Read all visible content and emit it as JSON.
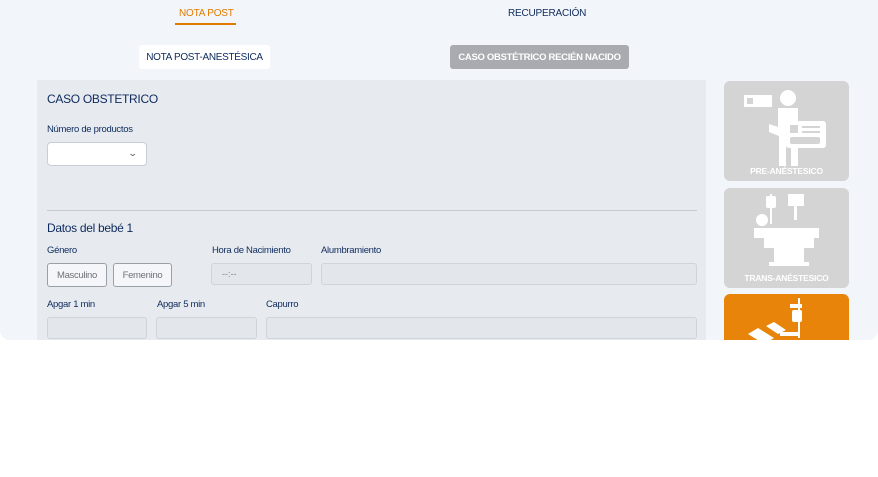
{
  "tabs": {
    "nota_post": "NOTA POST",
    "recuperacion": "RECUPERACIÓN"
  },
  "subtabs": {
    "post_anestesica": "NOTA POST-ANESTÉSICA",
    "caso_obstetrico": "CASO OBSTÉTRICO RECIÉN NACIDO"
  },
  "form": {
    "section_title": "CASO OBSTETRICO",
    "num_productos_label": "Número de productos",
    "num_productos_value": "",
    "baby_title": "Datos del bebé 1",
    "genero_label": "Género",
    "masculino": "Masculino",
    "femenino": "Femenino",
    "hora_label": "Hora de Nacimiento",
    "hora_placeholder": "--:--",
    "alumbramiento_label": "Alumbramiento",
    "apgar1_label": "Apgar 1 min",
    "apgar5_label": "Apgar 5 min",
    "capurro_label": "Capurro"
  },
  "side": {
    "pre_label": "PRE-ANÉSTESICO",
    "trans_label": "TRANS-ANÉSTESICO"
  },
  "colors": {
    "accent": "#e07b00",
    "navy": "#0e2a5c",
    "card_inactive": "#d4d4d4",
    "card_active": "#e88409"
  },
  "icons": [
    "doctor-monitor-icon",
    "patient-bed-icon",
    "iv-drip-icon"
  ]
}
